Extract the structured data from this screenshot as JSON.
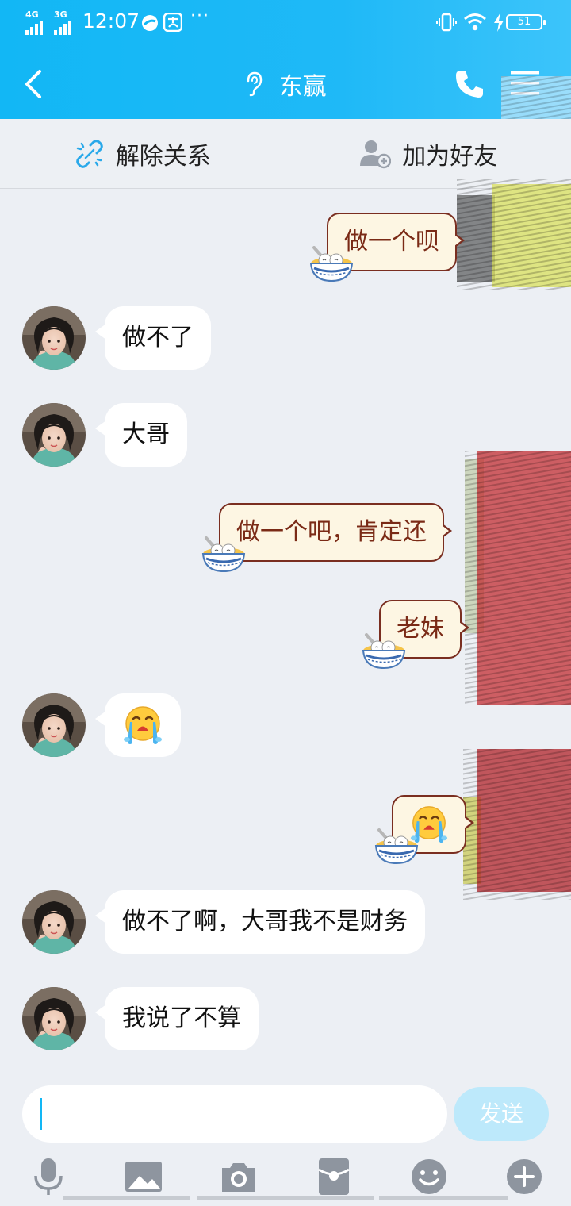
{
  "status_bar": {
    "network_1": "4G",
    "network_2": "3G",
    "time": "12:07",
    "battery": "51"
  },
  "header": {
    "back_icon": "chevron-left-icon",
    "ear_icon": "ear-icon",
    "title": "东赢",
    "call_icon": "phone-icon",
    "menu_icon": "menu-icon",
    "color": "#12b7f5"
  },
  "action_bar": {
    "unlink_label": "解除关系",
    "add_friend_label": "加为好友"
  },
  "messages": [
    {
      "side": "me",
      "text": "做一个呗"
    },
    {
      "side": "other",
      "text": "做不了"
    },
    {
      "side": "other",
      "text": "大哥"
    },
    {
      "side": "me",
      "text": "做一个吧，肯定还"
    },
    {
      "side": "me",
      "text": "老妹"
    },
    {
      "side": "other",
      "emoji": "crying-emoji"
    },
    {
      "side": "me",
      "emoji": "crying-emoji"
    },
    {
      "side": "other",
      "text": "做不了啊，大哥我不是财务"
    },
    {
      "side": "other",
      "text": "我说了不算"
    }
  ],
  "input": {
    "value": "",
    "send_label": "发送"
  },
  "toolbar": {
    "icons": [
      "microphone-icon",
      "image-icon",
      "camera-icon",
      "red-packet-icon",
      "emoji-icon",
      "plus-icon"
    ]
  }
}
